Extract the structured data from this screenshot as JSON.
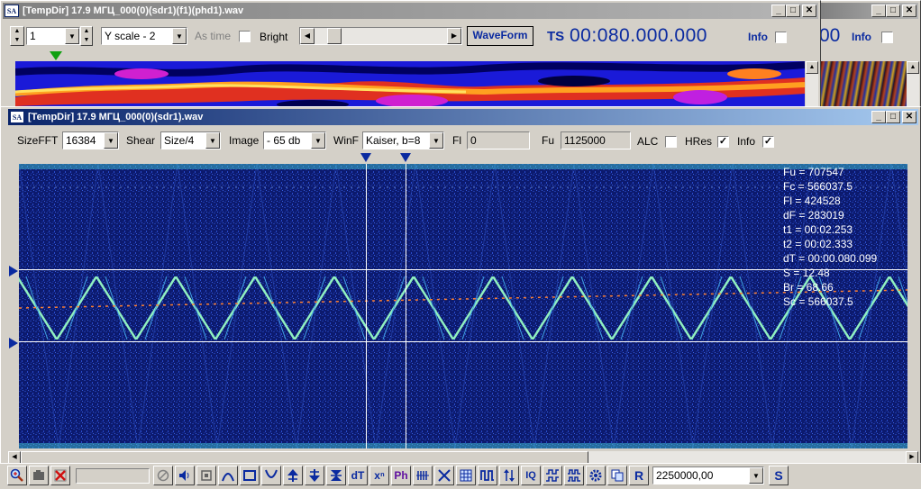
{
  "window_back": {
    "title": "[TempDir] 17.9 МГЦ_000(0)(sdr1)(f1)(phd1).wav",
    "spin_value": "1",
    "yscale_value": "Y scale - 2",
    "as_time_label": "As time",
    "bright_label": "Bright",
    "waveform_label": "WaveForm",
    "ts_label": "TS",
    "ts_value": "00:080.000.000",
    "info_label": "Info"
  },
  "window_right": {
    "ts_partial": "00",
    "info_label": "Info"
  },
  "window_main": {
    "title": "[TempDir] 17.9 МГЦ_000(0)(sdr1).wav",
    "toolbar": {
      "sizefft_label": "SizeFFT",
      "sizefft_value": "16384",
      "shear_label": "Shear",
      "shear_value": "Size/4",
      "image_label": "Image",
      "image_value": "- 65 db",
      "winf_label": "WinF",
      "winf_value": "Kaiser, b=8",
      "fl_label": "Fl",
      "fl_value": "0",
      "fu_label": "Fu",
      "fu_value": "1125000",
      "alc_label": "ALC",
      "alc_checked": false,
      "hres_label": "HRes",
      "hres_checked": true,
      "info_label": "Info",
      "info_checked": true
    },
    "readout": [
      "Fu = 707547",
      "Fc = 566037.5",
      "Fl = 424528",
      "dF = 283019",
      "t1 = 00:02.253",
      "t2 = 00:02.333",
      "dT = 00:00.080.099",
      "S = 12.48",
      "Br = 68.66",
      "Sc = 566037.5"
    ]
  },
  "bottom_toolbar": {
    "icons": [
      "zoom-icon",
      "camera-icon",
      "cross-icon",
      "blank-field",
      "circle-slash-icon",
      "speaker-icon",
      "stop-icon",
      "arc-up-icon",
      "square-icon",
      "arc-down-icon",
      "marker-up-icon",
      "marker-down-icon",
      "double-marker-icon",
      "dt-icon",
      "xn-icon",
      "ph-icon",
      "bars-icon",
      "cross-wave-icon",
      "grid-icon",
      "pulse-icon",
      "updown-icon",
      "iq-icon",
      "sync-icon",
      "sync2-icon",
      "gear-icon",
      "copy-icon",
      "r-icon",
      "combo",
      "s-icon"
    ],
    "labels": {
      "dt": "dT",
      "xn": "xⁿ",
      "ph": "Ph",
      "iq": "IQ",
      "r": "R",
      "s": "S"
    },
    "frequency_value": "2250000,00"
  },
  "colors": {
    "title_active": "#0a246a",
    "title_inactive": "#808080",
    "spectrogram_bg": "#0c1a6e",
    "accent_blue": "#0a2aa0"
  }
}
